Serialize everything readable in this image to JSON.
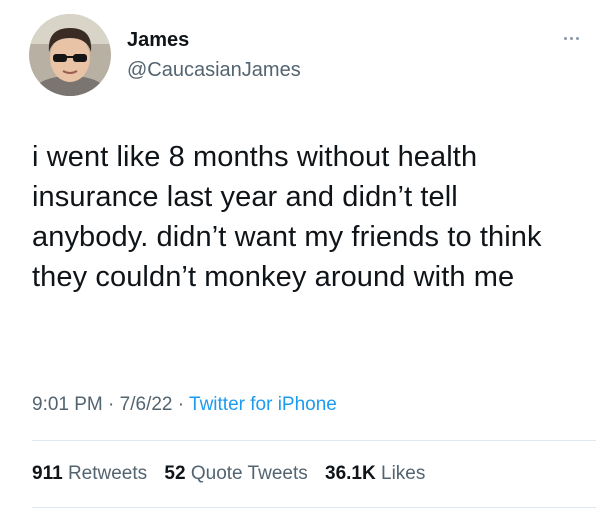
{
  "author": {
    "display_name": "James",
    "handle": "@CaucasianJames",
    "avatar_icon": "profile-photo-sunglasses"
  },
  "more_icon": "more-options-icon",
  "tweet": {
    "text": "i went like 8 months without health insurance last year and didn’t tell anybody. didn’t want my friends to think they couldn’t monkey around with me"
  },
  "meta": {
    "time": "9:01 PM",
    "separator": "·",
    "date": "7/6/22",
    "source": "Twitter for iPhone"
  },
  "stats": {
    "retweets_count": "911",
    "retweets_label": "Retweets",
    "quotes_count": "52",
    "quotes_label": "Quote Tweets",
    "likes_count": "36.1K",
    "likes_label": "Likes"
  },
  "colors": {
    "text": "#0f1419",
    "secondary": "#536471",
    "link": "#1d9bf0",
    "divider": "#e1e8ed"
  }
}
